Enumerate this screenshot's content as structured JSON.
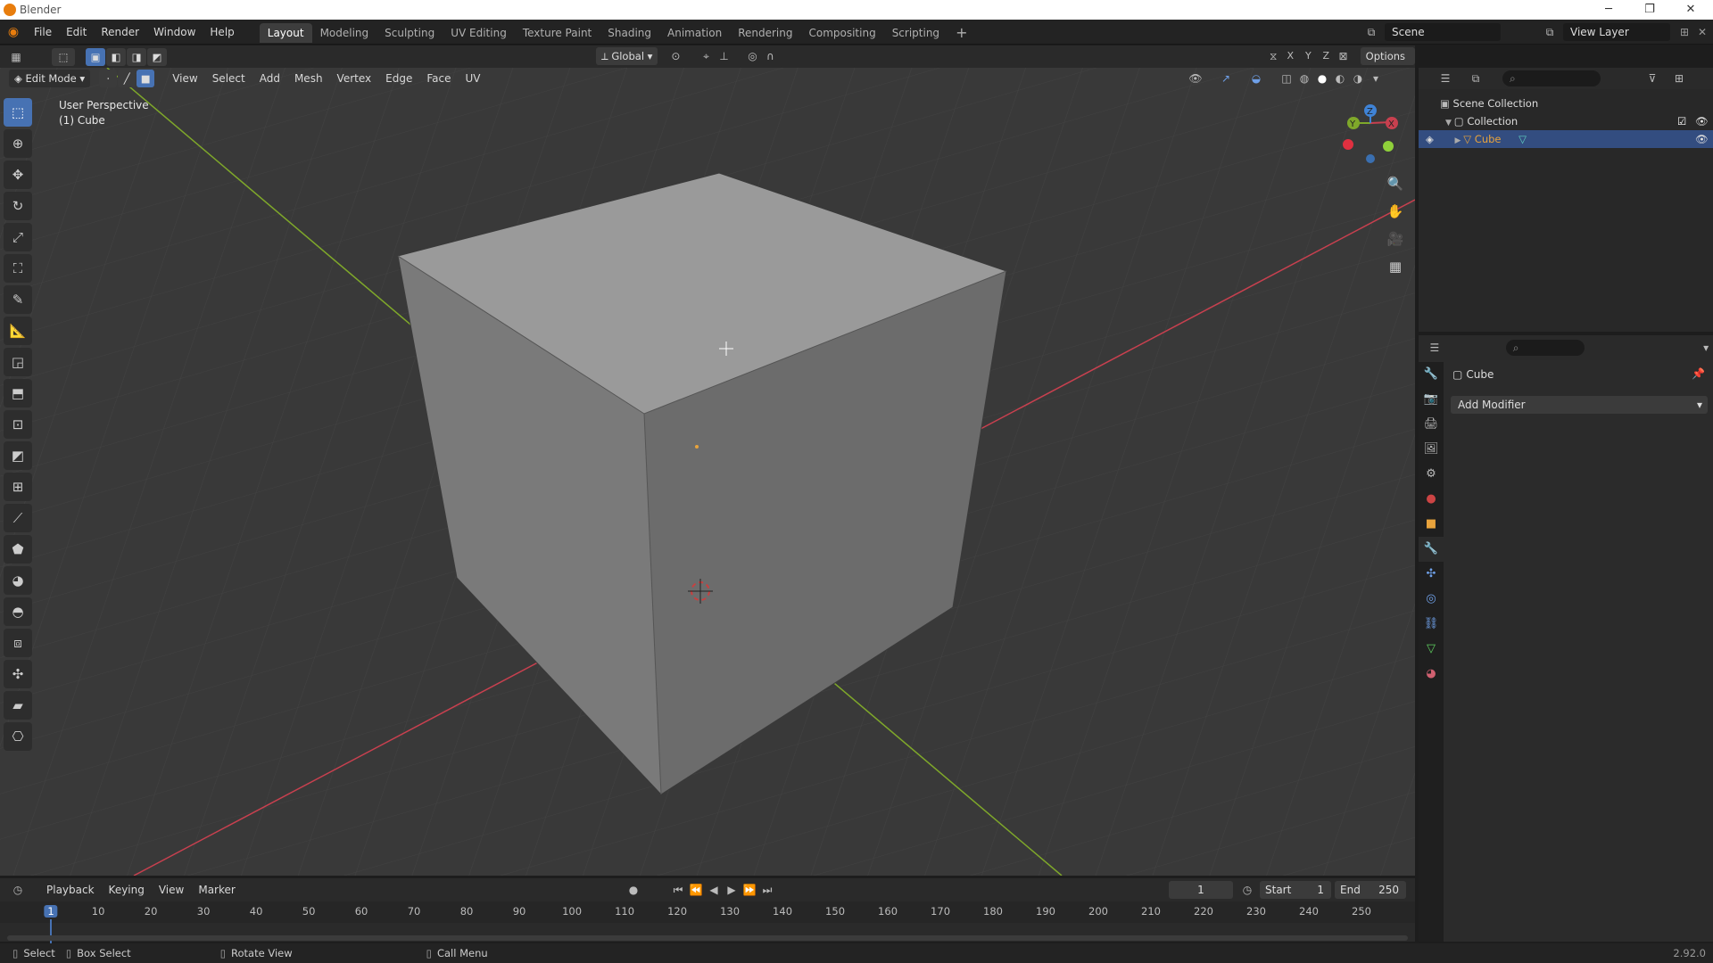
{
  "window": {
    "title": "Blender",
    "version": "2.92.0"
  },
  "menubar": {
    "menus": [
      "File",
      "Edit",
      "Render",
      "Window",
      "Help"
    ],
    "workspaces": [
      "Layout",
      "Modeling",
      "Sculpting",
      "UV Editing",
      "Texture Paint",
      "Shading",
      "Animation",
      "Rendering",
      "Compositing",
      "Scripting"
    ],
    "active_workspace": "Layout",
    "add_workspace": "+",
    "scene_label": "Scene",
    "view_layer_label": "View Layer"
  },
  "viewport_header": {
    "mode": "Edit Mode",
    "menus": [
      "View",
      "Select",
      "Add",
      "Mesh",
      "Vertex",
      "Edge",
      "Face",
      "UV"
    ],
    "transform_orientation": "Global",
    "options_label": "Options",
    "axes": [
      "X",
      "Y",
      "Z"
    ]
  },
  "viewport": {
    "perspective_label": "User Perspective",
    "object_label": "(1) Cube",
    "gizmo_axes": [
      "X",
      "Y",
      "Z"
    ]
  },
  "outliner": {
    "scene_collection": "Scene Collection",
    "collection": "Collection",
    "object": "Cube"
  },
  "properties": {
    "object_name": "Cube",
    "add_modifier_label": "Add Modifier"
  },
  "timeline": {
    "menus": [
      "Playback",
      "Keying",
      "View",
      "Marker"
    ],
    "current_frame": "1",
    "start_label": "Start",
    "start_value": "1",
    "end_label": "End",
    "end_value": "250",
    "ticks": [
      "1",
      "10",
      "20",
      "30",
      "40",
      "50",
      "60",
      "70",
      "80",
      "90",
      "100",
      "110",
      "120",
      "130",
      "140",
      "150",
      "160",
      "170",
      "180",
      "190",
      "200",
      "210",
      "220",
      "230",
      "240",
      "250"
    ]
  },
  "statusbar": {
    "select": "Select",
    "box_select": "Box Select",
    "rotate_view": "Rotate View",
    "call_menu": "Call Menu"
  },
  "colors": {
    "accent": "#4772b3",
    "x_axis": "#c8404f",
    "y_axis": "#7fa82a",
    "z_axis": "#3f83d6",
    "selected": "#e8a33c"
  }
}
